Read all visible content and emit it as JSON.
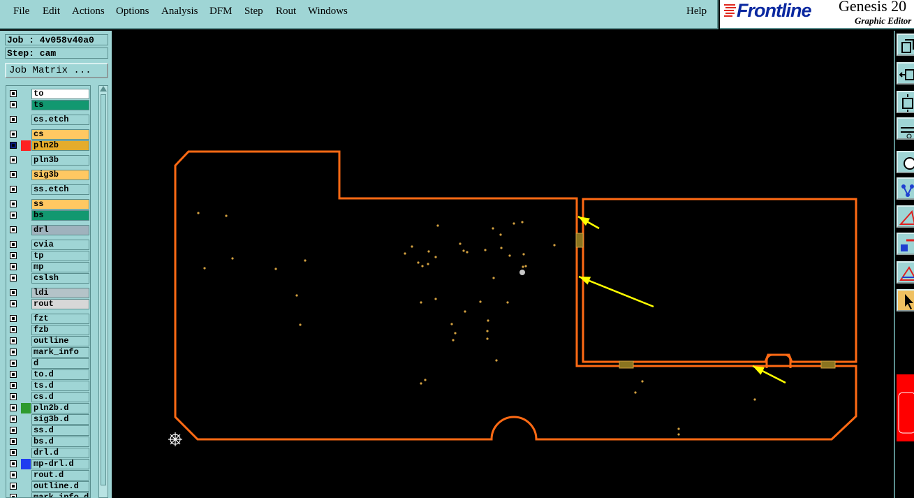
{
  "menubar": {
    "items": [
      {
        "label": "File",
        "key": "F"
      },
      {
        "label": "Edit",
        "key": "E"
      },
      {
        "label": "Actions",
        "key": "A"
      },
      {
        "label": "Options",
        "key": "O"
      },
      {
        "label": "Analysis",
        "key": "A"
      },
      {
        "label": "DFM",
        "key": "D"
      },
      {
        "label": "Step",
        "key": "S"
      },
      {
        "label": "Rout",
        "key": "R"
      },
      {
        "label": "Windows",
        "key": "W"
      }
    ],
    "help": "Help"
  },
  "brand": {
    "logo": "Frontline",
    "title": "Genesis 20",
    "subtitle": "Graphic Editor",
    "logo_color": "#0a28a0",
    "bars_color": "#e0281e"
  },
  "sidebar": {
    "job": "Job : 4v058v40a0",
    "step": "Step: cam",
    "job_matrix": "Job Matrix ..."
  },
  "layers": [
    {
      "name": "to",
      "bg": "#ffffff",
      "swatch": ""
    },
    {
      "name": "ts",
      "bg": "#129870",
      "swatch": ""
    },
    {
      "name": "cs.etch",
      "bg": "#9fd5d5",
      "swatch": ""
    },
    {
      "name": "cs",
      "bg": "#ffc862",
      "swatch": ""
    },
    {
      "name": "pln2b",
      "bg": "#e4ac2c",
      "swatch": "#ff2020",
      "active": true
    },
    {
      "name": "pln3b",
      "bg": "#9fd5d5",
      "swatch": ""
    },
    {
      "name": "sig3b",
      "bg": "#ffc862",
      "swatch": ""
    },
    {
      "name": "ss.etch",
      "bg": "#9fd5d5",
      "swatch": ""
    },
    {
      "name": "ss",
      "bg": "#ffc862",
      "swatch": ""
    },
    {
      "name": "bs",
      "bg": "#129870",
      "swatch": ""
    },
    {
      "name": "drl",
      "bg": "#9fb2bd",
      "swatch": ""
    },
    {
      "name": "cvia",
      "bg": "#9fd5d5",
      "swatch": ""
    },
    {
      "name": "tp",
      "bg": "#9fd5d5",
      "swatch": ""
    },
    {
      "name": "mp",
      "bg": "#9fd5d5",
      "swatch": ""
    },
    {
      "name": "cslsh",
      "bg": "#9fd5d5",
      "swatch": ""
    },
    {
      "name": "ldi",
      "bg": "#b4c3c8",
      "swatch": ""
    },
    {
      "name": "rout",
      "bg": "#d7d7d7",
      "swatch": ""
    },
    {
      "name": "fzt",
      "bg": "#9fd5d5",
      "swatch": ""
    },
    {
      "name": "fzb",
      "bg": "#9fd5d5",
      "swatch": ""
    },
    {
      "name": "outline",
      "bg": "#9fd5d5",
      "swatch": ""
    },
    {
      "name": "mark_info",
      "bg": "#9fd5d5",
      "swatch": ""
    },
    {
      "name": "d",
      "bg": "#9fd5d5",
      "swatch": ""
    },
    {
      "name": "to.d",
      "bg": "#9fd5d5",
      "swatch": ""
    },
    {
      "name": "ts.d",
      "bg": "#9fd5d5",
      "swatch": ""
    },
    {
      "name": "cs.d",
      "bg": "#9fd5d5",
      "swatch": ""
    },
    {
      "name": "pln2b.d",
      "bg": "#9fd5d5",
      "swatch": "#2e9a2e"
    },
    {
      "name": "sig3b.d",
      "bg": "#9fd5d5",
      "swatch": ""
    },
    {
      "name": "ss.d",
      "bg": "#9fd5d5",
      "swatch": ""
    },
    {
      "name": "bs.d",
      "bg": "#9fd5d5",
      "swatch": ""
    },
    {
      "name": "drl.d",
      "bg": "#9fd5d5",
      "swatch": ""
    },
    {
      "name": "mp-drl.d",
      "bg": "#9fd5d5",
      "swatch": "#1e3cf0"
    },
    {
      "name": "rout.d",
      "bg": "#9fd5d5",
      "swatch": ""
    },
    {
      "name": "outline.d",
      "bg": "#9fd5d5",
      "swatch": ""
    },
    {
      "name": "mark_info.d",
      "bg": "#9fd5d5",
      "swatch": ""
    }
  ],
  "colors": {
    "board_outline": "#ff6a14",
    "pads": "#d2a040",
    "arrows": "#ffff00",
    "panel_bg": "#9fd5d5"
  },
  "toolbar": {
    "icons": [
      "copy-icon",
      "move-icon",
      "resize-icon",
      "pick-icon",
      "circle-icon",
      "connect-icon",
      "draw-icon",
      "attribute-icon",
      "measure-icon",
      "select-arrow-icon"
    ]
  }
}
